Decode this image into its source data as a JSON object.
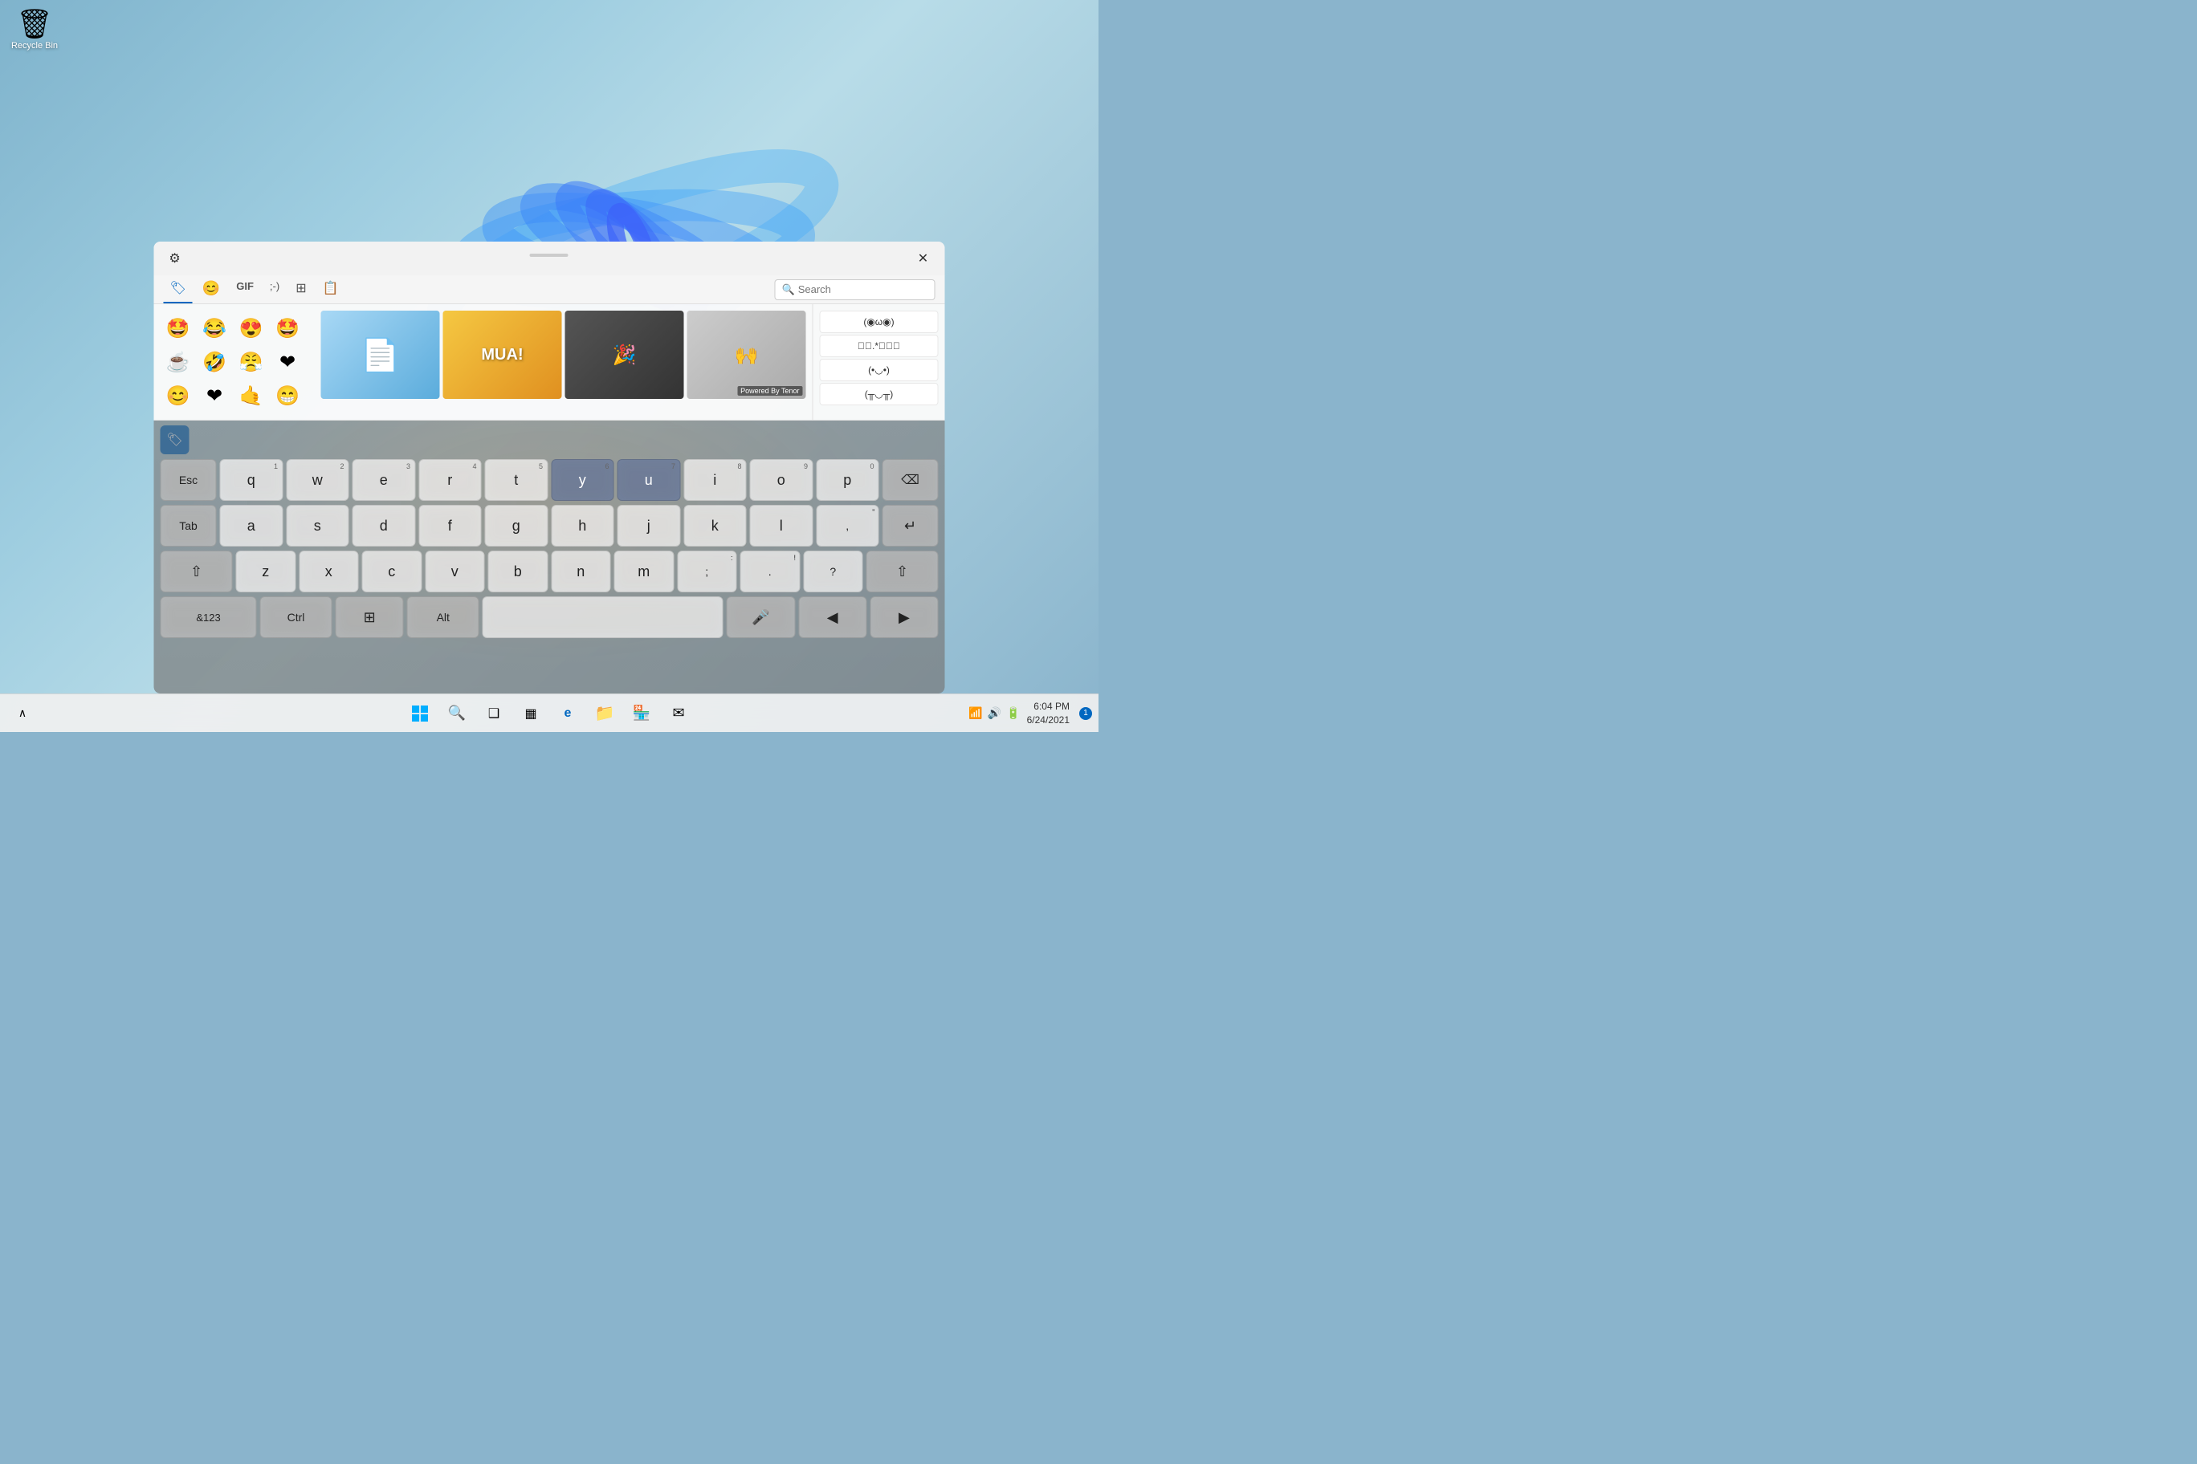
{
  "desktop": {
    "bg_color": "#8ab4cc"
  },
  "recycle_bin": {
    "label": "Recycle Bin",
    "icon": "🗑"
  },
  "emoji_picker": {
    "settings_icon": "⚙",
    "close_icon": "✕",
    "tabs": [
      {
        "id": "emoji",
        "icon": "🏷",
        "label": "Emoji",
        "active": true
      },
      {
        "id": "smiley",
        "icon": "😊",
        "label": "Smiley"
      },
      {
        "id": "gif",
        "icon": "GIF",
        "label": "GIF"
      },
      {
        "id": "kaomoji",
        "icon": ";-)",
        "label": "Kaomoji"
      },
      {
        "id": "symbols",
        "icon": "⊞",
        "label": "Symbols"
      },
      {
        "id": "clipboard",
        "icon": "📋",
        "label": "Clipboard"
      }
    ],
    "search_placeholder": "Search",
    "emojis": [
      "🤩",
      "😂",
      "😍",
      "🤩",
      "☕",
      "🤣",
      "😤",
      "❤",
      "😊",
      "❤",
      "🤙",
      "😁"
    ],
    "gifs": [
      {
        "id": "gif1",
        "color": "#a8d4f5",
        "text": ""
      },
      {
        "id": "gif2",
        "color": "#f5d76e",
        "text": "MUA!"
      },
      {
        "id": "gif3",
        "color": "#666",
        "text": ""
      },
      {
        "id": "gif4",
        "color": "#bbb",
        "text": ""
      }
    ],
    "powered_by": "Powered By Tenor",
    "kaomoji": [
      "(◉ω◉)",
      "☆ﾟ.*･｡ﾟ",
      "(•◡•)",
      "(╥◡╥)"
    ]
  },
  "keyboard": {
    "top_icon": "🏷",
    "rows": {
      "row1": {
        "special": "Esc",
        "keys": [
          "q",
          "w",
          "e",
          "r",
          "t",
          "y",
          "u",
          "i",
          "o",
          "p"
        ],
        "numbers": [
          "1",
          "2",
          "3",
          "4",
          "5",
          "6",
          "7",
          "8",
          "9",
          "0"
        ],
        "backspace": "⌫"
      },
      "row2": {
        "special": "Tab",
        "keys": [
          "a",
          "s",
          "d",
          "f",
          "g",
          "h",
          "j",
          "k",
          "l"
        ],
        "extra": [
          ",",
          "\""
        ],
        "enter": "↵"
      },
      "row3": {
        "special": "⇧",
        "keys": [
          "z",
          "x",
          "c",
          "v",
          "b",
          "n",
          "m"
        ],
        "extra": [
          ";",
          ":",
          "!",
          "?"
        ],
        "shift": "⇧"
      },
      "row4": {
        "sym": "&123",
        "ctrl": "Ctrl",
        "win": "⊞",
        "alt": "Alt",
        "space": "",
        "mic": "🎤",
        "left": "◀",
        "right": "▶"
      }
    }
  },
  "taskbar": {
    "start_icon": "⊞",
    "search_icon": "🔍",
    "taskview_icon": "❑",
    "widgets_icon": "▦",
    "edge_icon": "e",
    "explorer_icon": "📁",
    "store_icon": "🏪",
    "mail_icon": "✉",
    "time": "6:04 PM",
    "date": "6/24/2021",
    "notification_count": "1"
  }
}
